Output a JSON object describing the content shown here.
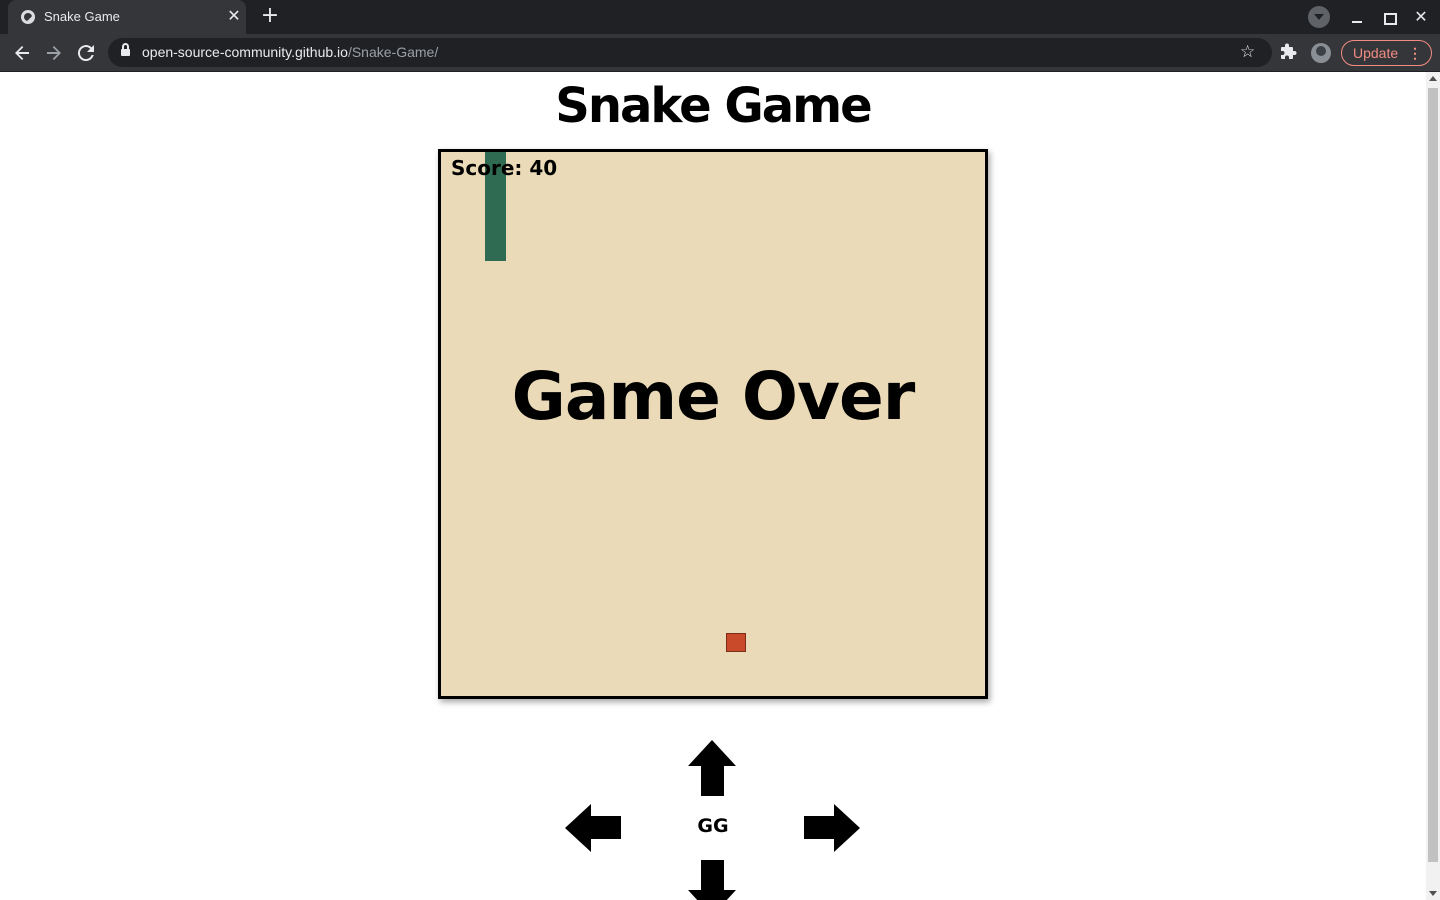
{
  "browser": {
    "tab_title": "Snake Game",
    "tab_close": "✕",
    "new_tab": "+",
    "url_host": "open-source-community.github.io",
    "url_path": "/Snake-Game/",
    "update_label": "Update",
    "update_menu": "⋮",
    "icons": {
      "back": "arrow-left-icon",
      "forward": "arrow-right-icon",
      "reload": "reload-icon",
      "lock": "lock-icon",
      "star": "star-icon",
      "extensions": "puzzle-icon"
    },
    "accent_color": "#f28b82"
  },
  "page": {
    "title": "Snake Game"
  },
  "game": {
    "score_text": "Score: 40",
    "status_text": "Game Over",
    "board_color": "#eadab7",
    "snake_color": "#2f6b52",
    "food_color": "#c94a2a",
    "grid_columns": 25,
    "grid_rows": 25,
    "snake": [
      [
        2,
        0
      ],
      [
        2,
        1
      ],
      [
        2,
        2
      ],
      [
        2,
        3
      ],
      [
        2,
        4
      ]
    ],
    "food": [
      13,
      22
    ]
  },
  "controls": {
    "center_label": "GG",
    "buttons": [
      "up-arrow-button",
      "left-arrow-button",
      "right-arrow-button",
      "down-arrow-button"
    ]
  }
}
